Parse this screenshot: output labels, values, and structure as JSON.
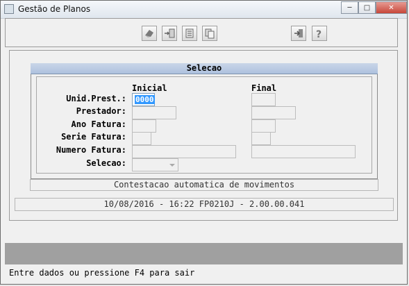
{
  "window": {
    "title": "Gestão de Planos"
  },
  "toolbar": {
    "icons": [
      "delete-record-icon",
      "import-icon",
      "list-icon",
      "copy-icon",
      "exit-icon",
      "help-icon"
    ]
  },
  "selection": {
    "header": "Selecao",
    "col_initial": "Inicial",
    "col_final": "Final",
    "labels": {
      "unid_prest": "Unid.Prest.:",
      "prestador": "Prestador:",
      "ano_fatura": "Ano Fatura:",
      "serie_fatura": "Serie Fatura:",
      "numero_fatura": "Numero Fatura:",
      "selecao": "Selecao:"
    },
    "values": {
      "unid_prest_initial": "0000"
    }
  },
  "info_bar": "Contestacao automatica de movimentos",
  "version_bar": "10/08/2016 - 16:22  FP0210J - 2.00.00.041",
  "status_line": "Entre dados ou pressione F4 para sair"
}
